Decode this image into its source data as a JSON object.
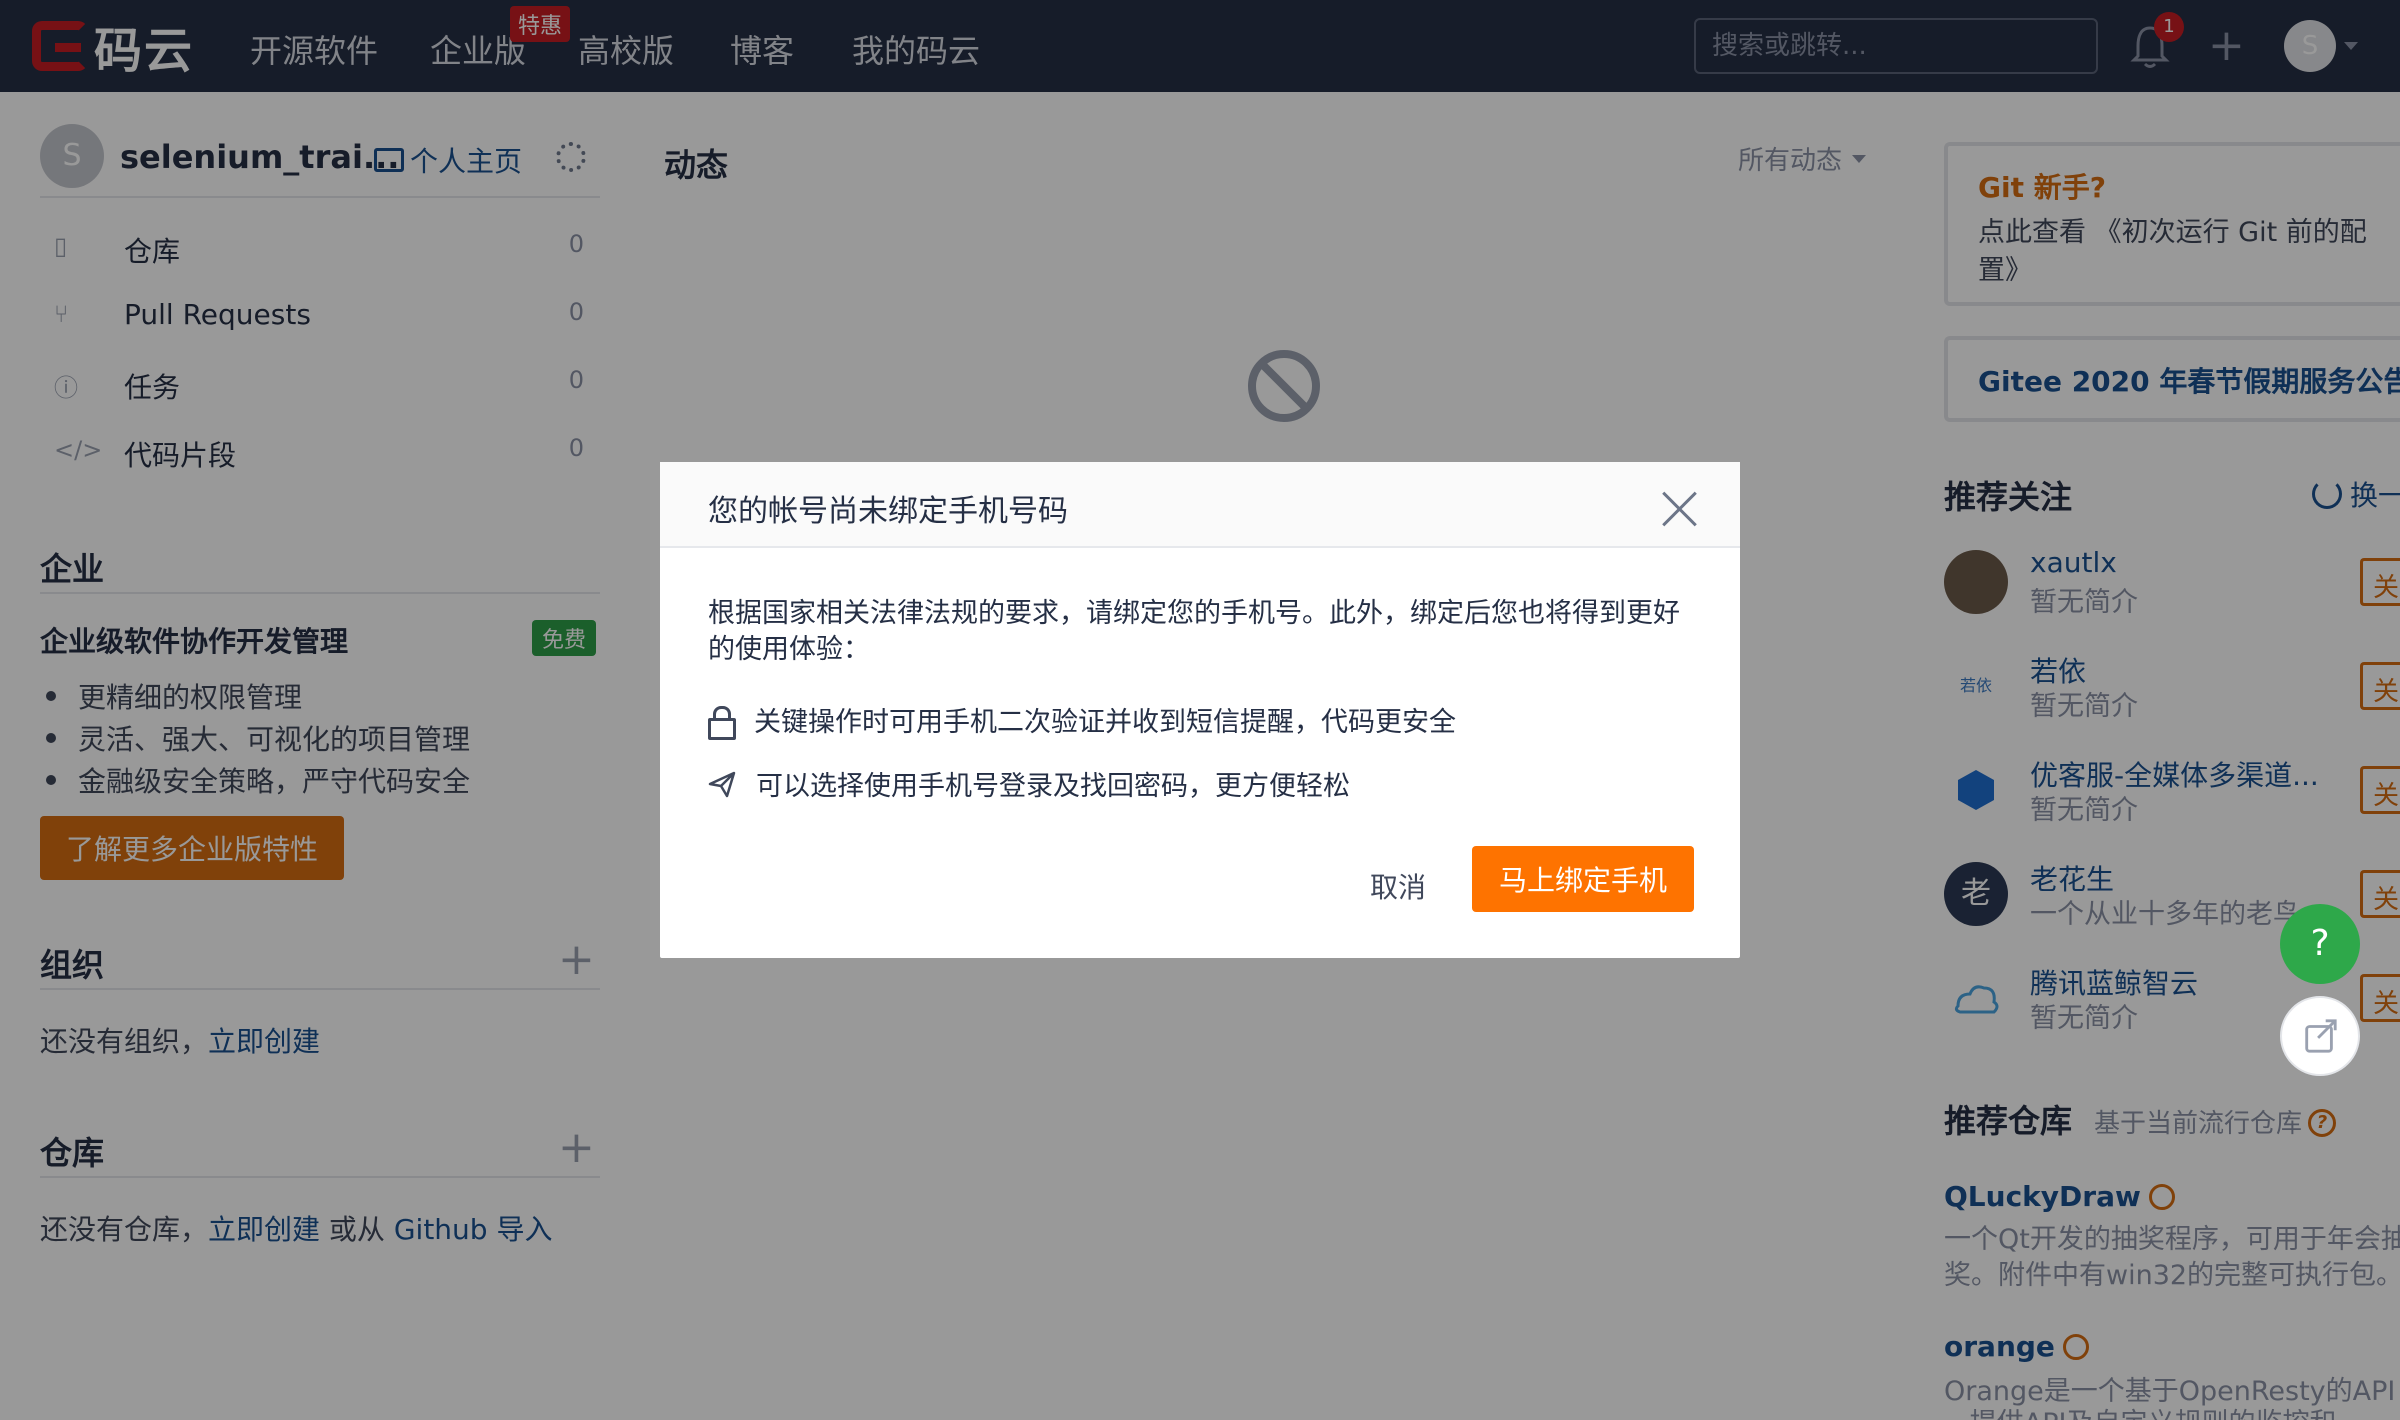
{
  "nav": {
    "logo_text": "码云",
    "links": [
      "开源软件",
      "企业版",
      "高校版",
      "博客",
      "我的码云"
    ],
    "enterprise_badge": "特惠",
    "search_placeholder": "搜索或跳转...",
    "notification_count": "1",
    "avatar_letter": "S"
  },
  "sidebar": {
    "avatar_letter": "S",
    "username": "selenium_trai...",
    "homepage_link": "个人主页",
    "items": [
      {
        "label": "仓库",
        "count": "0",
        "icon": "book-icon"
      },
      {
        "label": "Pull Requests",
        "count": "0",
        "icon": "pull-request-icon"
      },
      {
        "label": "任务",
        "count": "0",
        "icon": "issue-icon"
      },
      {
        "label": "代码片段",
        "count": "0",
        "icon": "code-icon"
      }
    ],
    "enterprise": {
      "section_title": "企业",
      "title": "企业级软件协作开发管理",
      "badge": "免费",
      "features": [
        "更精细的权限管理",
        "灵活、强大、可视化的项目管理",
        "金融级安全策略，严守代码安全"
      ],
      "button": "了解更多企业版特性"
    },
    "org": {
      "title": "组织",
      "note_prefix": "还没有组织，",
      "note_link": "立即创建"
    },
    "repo": {
      "title": "仓库",
      "note_prefix": "还没有仓库，",
      "note_link": "立即创建",
      "note_middle": " 或从 ",
      "note_link2": "Github 导入"
    }
  },
  "activity": {
    "title": "动态",
    "filter": "所有动态"
  },
  "right": {
    "tip_title": "Git 新手?",
    "tip_body": "点此查看 《初次运行 Git 前的配置》",
    "notice": "Gitee 2020 年春节假期服务公告",
    "recommend_title": "推荐关注",
    "switch_label": "换一",
    "follow_label": "关",
    "users": [
      {
        "name": "xautlx",
        "desc": "暂无简介"
      },
      {
        "name": "若依",
        "desc": "暂无简介"
      },
      {
        "name": "优客服-全媒体多渠道...",
        "desc": "暂无简介"
      },
      {
        "name": "老花生",
        "desc": "一个从业十多年的老鸟"
      },
      {
        "name": "腾讯蓝鲸智云",
        "desc": "暂无简介"
      }
    ],
    "repo_title": "推荐仓库",
    "repo_subtitle": "基于当前流行仓库",
    "repos": [
      {
        "name": "QLuckyDraw",
        "desc1": "一个Qt开发的抽奖程序，可用于年会抽",
        "desc2": "奖。附件中有win32的完整可执行包。"
      },
      {
        "name": "orange",
        "desc1": "Orange是一个基于OpenResty的API G",
        "desc2": "...提供API及自定义规则的监控和..."
      }
    ]
  },
  "fab": {
    "help": "?"
  },
  "modal": {
    "title": "您的帐号尚未绑定手机号码",
    "description": "根据国家相关法律法规的要求，请绑定您的手机号。此外，绑定后您也将得到更好的使用体验：",
    "benefit1": "关键操作时可用手机二次验证并收到短信提醒，代码更安全",
    "benefit2": "可以选择使用手机号登录及找回密码，更方便轻松",
    "cancel": "取消",
    "confirm": "马上绑定手机"
  },
  "colors": {
    "nav_bg": "#252f45",
    "brand_red": "#c71d23",
    "accent_orange": "#fe7300",
    "link_blue": "#1a5190",
    "free_green": "#2e9e48"
  }
}
